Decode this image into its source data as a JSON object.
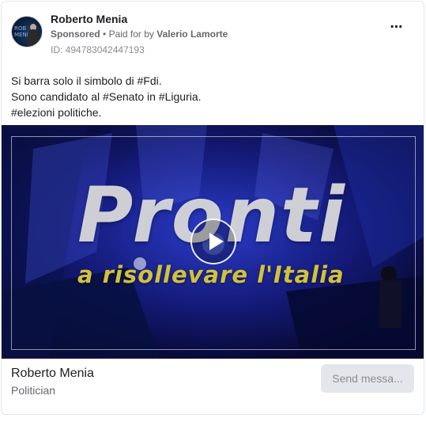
{
  "ad": {
    "page_name": "Roberto Menia",
    "sponsored_label": "Sponsored",
    "separator": "•",
    "paid_for_prefix": "Paid for by",
    "paid_for_name": "Valerio Lamorte",
    "id_label": "ID: 494783042447193",
    "more_icon": "⋯",
    "body_lines": [
      "Si barra solo il simbolo di #Fdi.",
      "Sono candidato al #Senato in #Liguria.",
      "#elezioni politiche."
    ],
    "video": {
      "title_overlay": "Pronti",
      "subtitle_overlay": "a risollevare l'Italia",
      "play_icon": "play-icon"
    },
    "footer": {
      "name": "Roberto Menia",
      "category": "Politician",
      "send_button": "Send messa..."
    }
  },
  "colors": {
    "accent_subtitle": "#d2c13a",
    "button_bg": "#e4e6eb",
    "muted_text": "#65676b"
  }
}
